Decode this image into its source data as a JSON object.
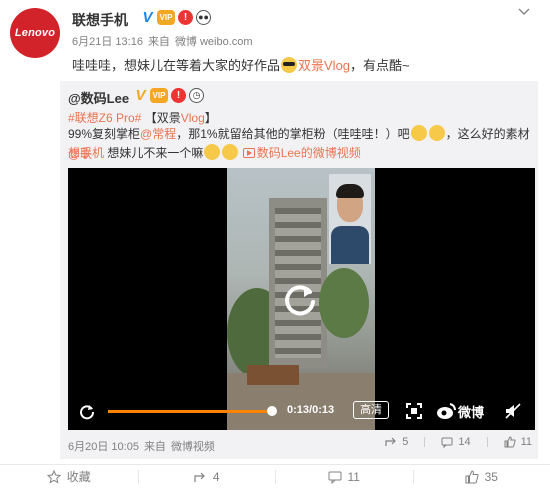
{
  "post": {
    "avatar_text": "Lenovo",
    "user_name": "联想手机",
    "time": "6月21日 13:16",
    "source_prefix": "来自",
    "source": "微博 weibo.com",
    "text_part1": "哇哇哇，想妹儿在等着大家的好作品",
    "text_link": "双景Vlog",
    "text_part2": "，有点酷~"
  },
  "repost": {
    "user": "@数码Lee",
    "topic": "#联想Z6 Pro#",
    "tag": "【双景",
    "tag_link": "Vlog",
    "tag_end": "】",
    "line3_part1": "99%复刻掌柜",
    "line3_mention": "@常程",
    "line3_part2": "，那1%就留给其他的掌柜粉（哇哇哇！）吧",
    "line3_part3": "，这么好的素材",
    "line3_mention2": "@联",
    "line4_mention": "想手机",
    "line4_text": " 想妹儿不来一个嘛",
    "video_link": "数码Lee的微博视频",
    "time": "6月20日 10:05",
    "source_prefix": "来自",
    "source": "微博视频",
    "actions": {
      "repost": "5",
      "comment": "14",
      "like": "11"
    }
  },
  "video": {
    "time_display": "0:13/0:13",
    "quality": "高清",
    "brand": "微博",
    "progress": 1.0
  },
  "actions": {
    "favorite": "收藏",
    "repost": "4",
    "comment": "11",
    "like": "35"
  },
  "colors": {
    "accent": "#eb7350",
    "progress": "#ff8200",
    "brand_red": "#d3232a",
    "verified": "#1e88e5"
  }
}
